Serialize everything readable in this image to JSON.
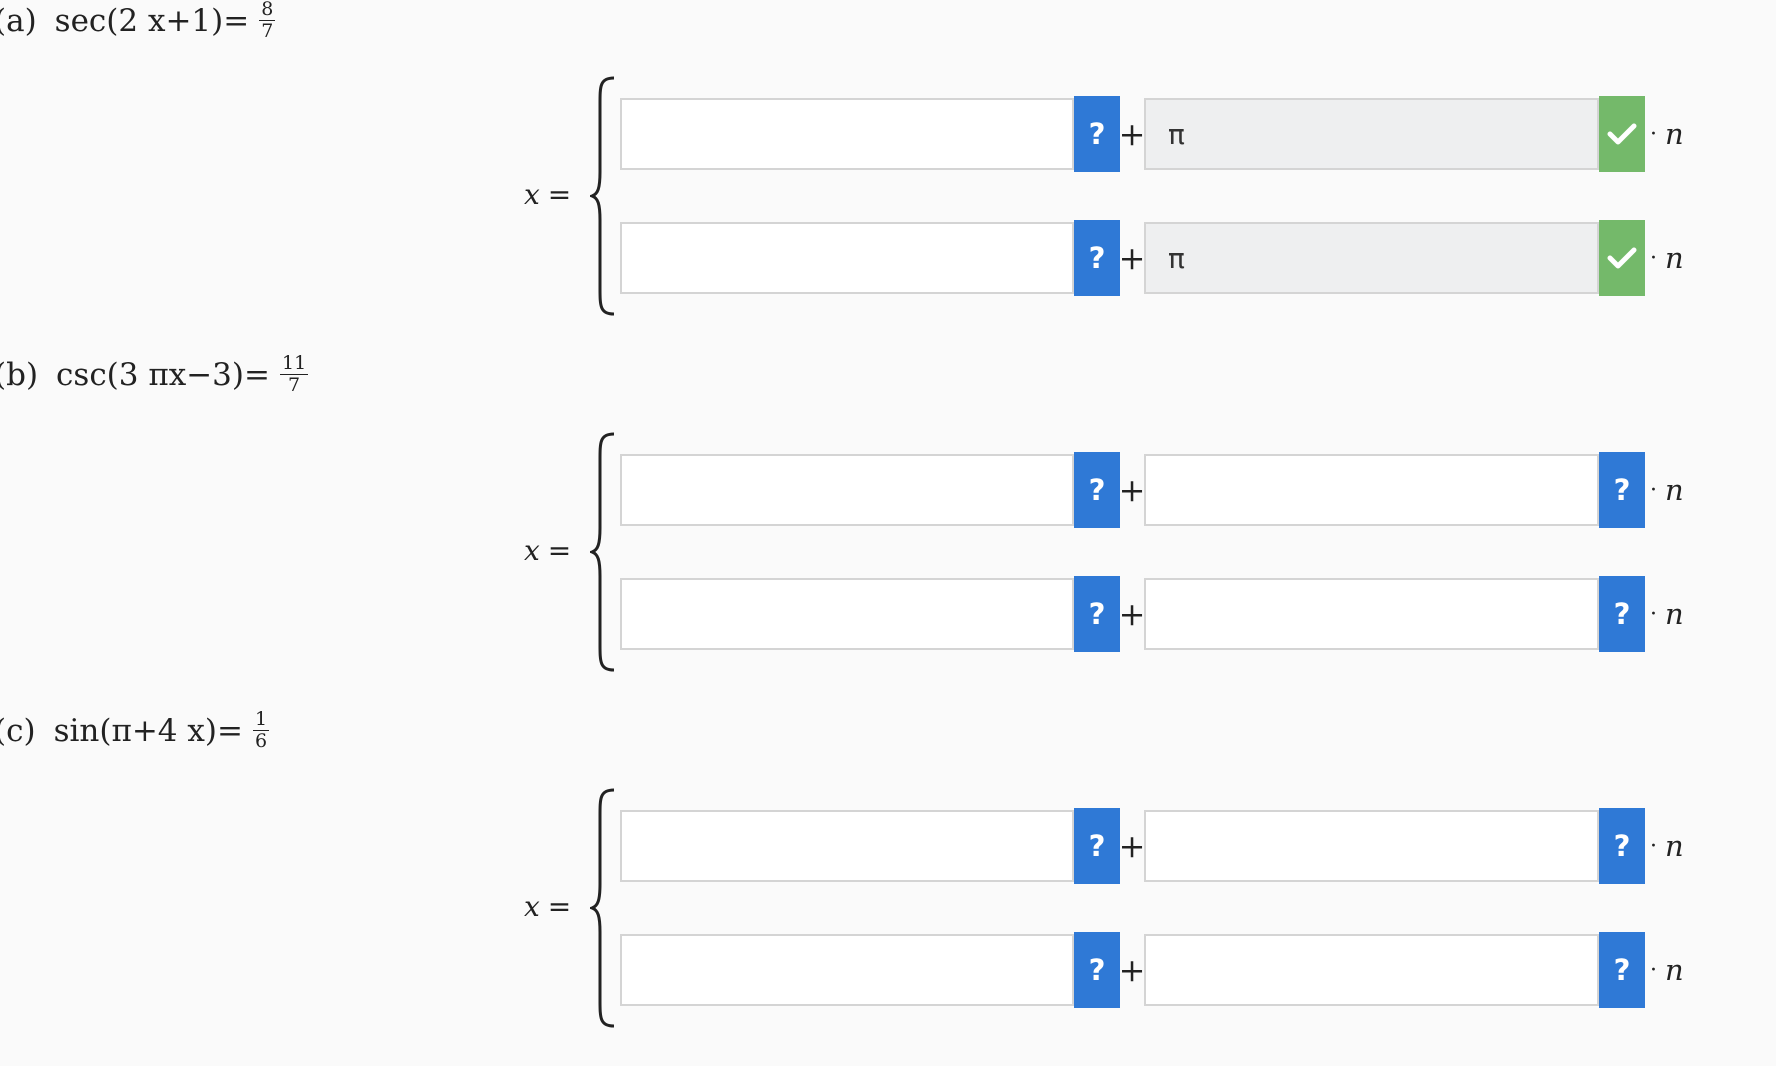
{
  "problems": [
    {
      "part": "(a)",
      "equation": "sec(2 x+1)=",
      "fraction": {
        "num": "8",
        "den": "7"
      },
      "x_label": "x",
      "equals": "=",
      "rows": [
        {
          "field1": "",
          "plus": "+",
          "field2": "π",
          "button1": "?",
          "button2_state": "correct",
          "suffix_dot": "·",
          "suffix_var": "n"
        },
        {
          "field1": "",
          "plus": "+",
          "field2": "π",
          "button1": "?",
          "button2_state": "correct",
          "suffix_dot": "·",
          "suffix_var": "n"
        }
      ]
    },
    {
      "part": "(b)",
      "equation": "csc(3 πx−3)=",
      "fraction": {
        "num": "11",
        "den": "7"
      },
      "x_label": "x",
      "equals": "=",
      "rows": [
        {
          "field1": "",
          "plus": "+",
          "field2": "",
          "button1": "?",
          "button2": "?",
          "suffix_dot": "·",
          "suffix_var": "n"
        },
        {
          "field1": "",
          "plus": "+",
          "field2": "",
          "button1": "?",
          "button2": "?",
          "suffix_dot": "·",
          "suffix_var": "n"
        }
      ]
    },
    {
      "part": "(c)",
      "equation": "sin(π+4 x)=",
      "fraction": {
        "num": "1",
        "den": "6"
      },
      "x_label": "x",
      "equals": "=",
      "rows": [
        {
          "field1": "",
          "plus": "+",
          "field2": "",
          "button1": "?",
          "button2": "?",
          "suffix_dot": "·",
          "suffix_var": "n"
        },
        {
          "field1": "",
          "plus": "+",
          "field2": "",
          "button1": "?",
          "button2": "?",
          "suffix_dot": "·",
          "suffix_var": "n"
        }
      ]
    }
  ],
  "colors": {
    "help_button": "#2f79d6",
    "correct_button": "#74b96a",
    "filled_field_bg": "#eeeff0"
  },
  "icons": {
    "correct": "check-icon",
    "help": "question-mark-icon"
  }
}
